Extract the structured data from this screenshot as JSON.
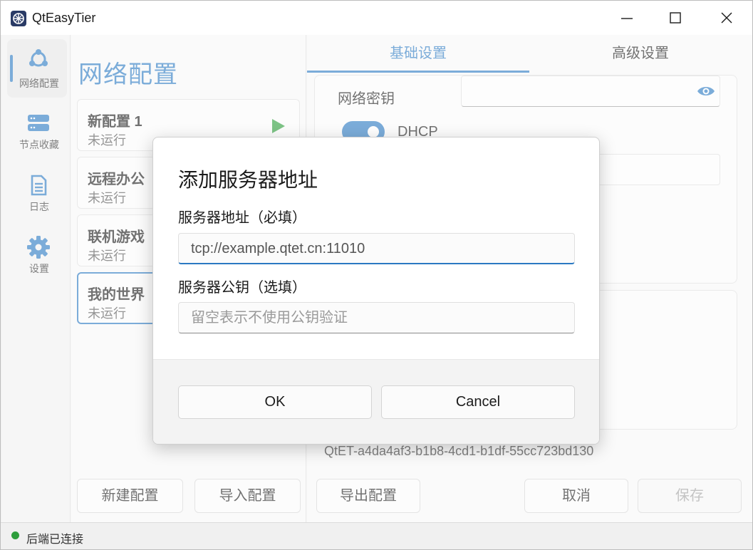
{
  "window": {
    "title": "QtEasyTier",
    "minimize_icon": "minimize-icon",
    "maximize_icon": "maximize-icon",
    "close_icon": "close-icon"
  },
  "sidebar": {
    "items": [
      {
        "label": "网络配置",
        "icon": "network-icon",
        "active": true
      },
      {
        "label": "节点收藏",
        "icon": "server-icon",
        "active": false
      },
      {
        "label": "日志",
        "icon": "document-icon",
        "active": false
      },
      {
        "label": "设置",
        "icon": "gear-icon",
        "active": false
      }
    ]
  },
  "config_list": {
    "heading": "网络配置",
    "items": [
      {
        "name": "新配置 1",
        "status": "未运行"
      },
      {
        "name": "远程办公",
        "status": "未运行"
      },
      {
        "name": "联机游戏",
        "status": "未运行"
      },
      {
        "name": "我的世界",
        "status": "未运行"
      }
    ],
    "new_button": "新建配置",
    "import_button": "导入配置"
  },
  "settings": {
    "tabs": [
      "基础设置",
      "高级设置"
    ],
    "network_key_label": "网络密钥",
    "dhcp_label": "DHCP",
    "instance_id": "QtET-a4da4af3-b1b8-4cd1-b1df-55cc723bd130",
    "export_button": "导出配置",
    "cancel_button": "取消",
    "save_button": "保存"
  },
  "dialog": {
    "title": "添加服务器地址",
    "address_label": "服务器地址（必填）",
    "address_value": "tcp://example.qtet.cn:11010",
    "pubkey_label": "服务器公钥（选填）",
    "pubkey_placeholder": "留空表示不使用公钥验证",
    "ok_button": "OK",
    "cancel_button": "Cancel"
  },
  "statusbar": {
    "text": "后端已连接"
  },
  "colors": {
    "accent": "#2b79c2",
    "running_green": "#2e9e3c"
  }
}
